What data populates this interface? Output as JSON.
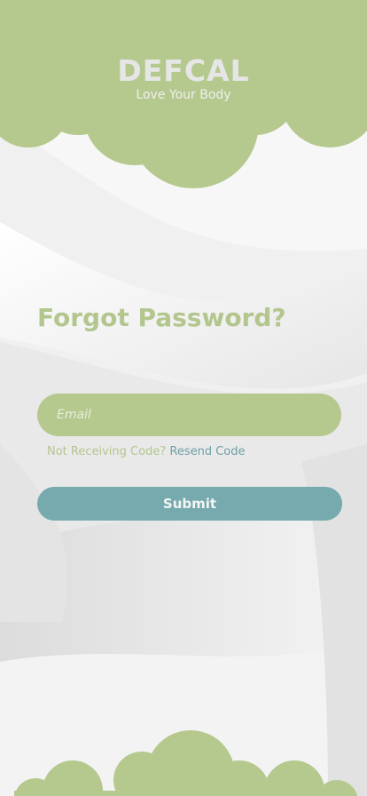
{
  "brand": {
    "title": "DEFCAL",
    "tagline": "Love Your Body"
  },
  "page": {
    "title": "Forgot Password?"
  },
  "form": {
    "email_placeholder": "Email",
    "email_value": "",
    "resend_prompt": "Not Receiving Code?",
    "resend_link": "Resend Code",
    "submit_label": "Submit"
  },
  "colors": {
    "accent_green": "#b5c98e",
    "accent_teal": "#76aaae",
    "background": "#f1f1f1"
  }
}
